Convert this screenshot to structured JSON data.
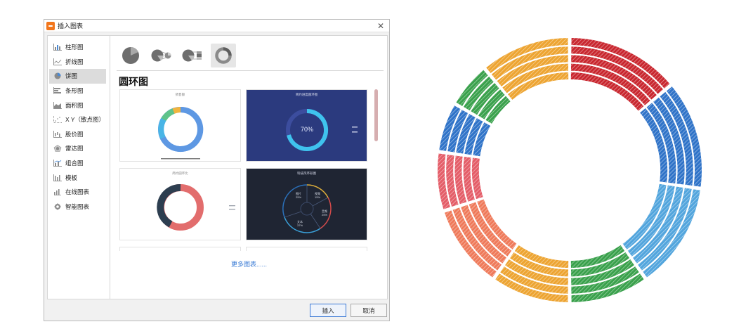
{
  "dialog": {
    "title": "插入图表",
    "close_glyph": "✕",
    "sidebar": [
      {
        "label": "柱形图",
        "icon": "column-chart-icon"
      },
      {
        "label": "折线图",
        "icon": "line-chart-icon"
      },
      {
        "label": "饼图",
        "icon": "pie-chart-icon",
        "active": true
      },
      {
        "label": "条形图",
        "icon": "bar-chart-icon"
      },
      {
        "label": "面积图",
        "icon": "area-chart-icon"
      },
      {
        "label": "X Y（散点图）",
        "icon": "scatter-chart-icon"
      },
      {
        "label": "股价图",
        "icon": "stock-chart-icon"
      },
      {
        "label": "雷达图",
        "icon": "radar-chart-icon"
      },
      {
        "label": "组合图",
        "icon": "combo-chart-icon"
      },
      {
        "label": "模板",
        "icon": "template-icon"
      },
      {
        "label": "在线图表",
        "icon": "online-chart-icon"
      },
      {
        "label": "智能图表",
        "icon": "smart-chart-icon"
      }
    ],
    "subtypes": [
      "pie",
      "exploded-pie",
      "bar-of-pie",
      "doughnut"
    ],
    "selected_subtype": "doughnut",
    "section_title": "圆环图",
    "thumbnails": [
      {
        "title": "销售额",
        "theme": "light"
      },
      {
        "title": "简约进度圆环图",
        "theme": "dark-blue",
        "center_text": "70%"
      },
      {
        "title": "简约圆环比",
        "theme": "light"
      },
      {
        "title": "科技风环形图",
        "theme": "dark",
        "labels": [
          {
            "name": "图片",
            "pct": "25%"
          },
          {
            "name": "视频",
            "pct": "15%"
          },
          {
            "name": "音频",
            "pct": "25%"
          },
          {
            "name": "文本",
            "pct": "37%"
          }
        ]
      }
    ],
    "more_link": "更多图表......",
    "insert_button": "插入",
    "cancel_button": "取消"
  },
  "colors": {
    "accent_blue": "#3a7bd5",
    "thumb_dark_blue": "#2b3a7e",
    "thumb_dark": "#1f2533",
    "donut_red": "#c9272f",
    "donut_orange": "#eda431",
    "donut_green": "#3aa14c",
    "donut_blue": "#2f73c8",
    "donut_sky": "#52a5dd",
    "donut_pink": "#e45d68",
    "donut_salmon": "#ef7a5a"
  }
}
